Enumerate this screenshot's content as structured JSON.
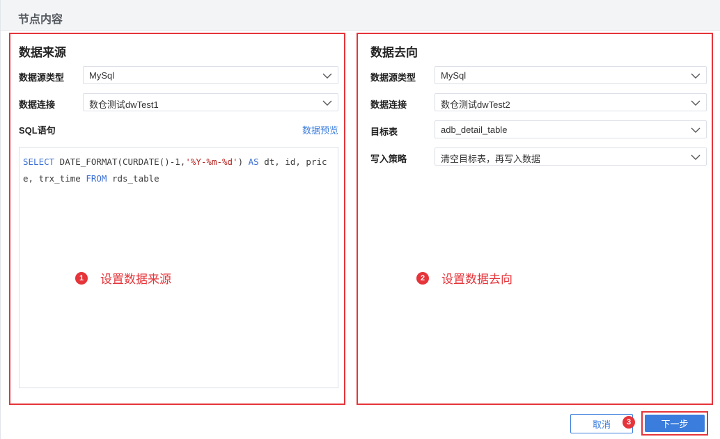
{
  "header": {
    "title": "节点内容"
  },
  "source": {
    "title": "数据来源",
    "type_label": "数据源类型",
    "type_value": "MySql",
    "conn_label": "数据连接",
    "conn_value": "数仓测试dwTest1",
    "sql_label": "SQL语句",
    "preview_link": "数据预览",
    "sql_parts": {
      "kw_select": "SELECT",
      "func": " DATE_FORMAT(CURDATE()-1,",
      "fmt": "'%Y-%m-%d'",
      "paren": ") ",
      "kw_as": "AS",
      "cols": " dt, id, price, trx_time ",
      "kw_from": "FROM",
      "table": " rds_table"
    }
  },
  "target": {
    "title": "数据去向",
    "type_label": "数据源类型",
    "type_value": "MySql",
    "conn_label": "数据连接",
    "conn_value": "数仓测试dwTest2",
    "table_label": "目标表",
    "table_value": "adb_detail_table",
    "strategy_label": "写入策略",
    "strategy_value": "清空目标表，再写入数据"
  },
  "annotations": {
    "one": {
      "num": "1",
      "text": "设置数据来源"
    },
    "two": {
      "num": "2",
      "text": "设置数据去向"
    },
    "three": {
      "num": "3"
    }
  },
  "footer": {
    "cancel_label": "取消",
    "next_label": "下一步"
  },
  "colors": {
    "accent": "#3b7ddd",
    "highlight": "#e5343a"
  },
  "icons": {
    "select_chevron": "chevron-down-icon"
  }
}
